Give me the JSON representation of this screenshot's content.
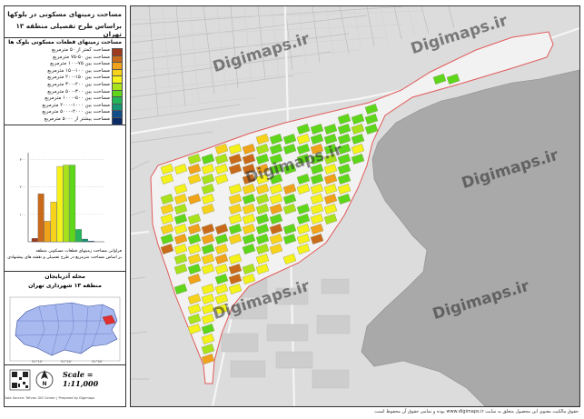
{
  "title": {
    "line1": "مساحت زمینهای مسکونی در بلوکها",
    "line2": "براساس طرح تفصیلی منطقه ۱۳ تهران"
  },
  "legend": {
    "title": "مساحت زمینهای قطعات مسکونی بلوک ها",
    "items": [
      {
        "label": "مساحت کمتر از ۵۰ مترمربع",
        "color": "#9e3b1e"
      },
      {
        "label": "مساحت بین ۵۰-۷۵ مترمربع",
        "color": "#c96a1a"
      },
      {
        "label": "مساحت بین ۷۵-۱۰۰ مترمربع",
        "color": "#f0a21a"
      },
      {
        "label": "مساحت بین ۱۰۰-۱۵۰ مترمربع",
        "color": "#f7d21a"
      },
      {
        "label": "مساحت بین ۱۵۰-۲۰۰ مترمربع",
        "color": "#f4f21a"
      },
      {
        "label": "مساحت بین ۲۰۰-۳۰۰ مترمربع",
        "color": "#a8e21a"
      },
      {
        "label": "مساحت بین ۳۰۰-۵۰۰ مترمربع",
        "color": "#5ed61a"
      },
      {
        "label": "مساحت بین ۵۰۰-۱۰۰۰ مترمربع",
        "color": "#24b45a"
      },
      {
        "label": "مساحت بین ۱۰۰۰-۲۰۰۰ مترمربع",
        "color": "#169474"
      },
      {
        "label": "مساحت بین ۲۰۰۰-۵۰۰۰ مترمربع",
        "color": "#104e8a"
      },
      {
        "label": "مساحت بیشتر از ۵۰۰۰ مترمربع",
        "color": "#0a2b66"
      }
    ]
  },
  "chart_data": {
    "type": "bar",
    "categories": [
      "<50",
      "50-75",
      "75-100",
      "100-150",
      "150-200",
      "200-300",
      "300-500",
      "500-1000",
      "1000-2000",
      "2000-5000",
      ">5000"
    ],
    "values": [
      5,
      70,
      30,
      58,
      110,
      112,
      112,
      18,
      4,
      1,
      0
    ],
    "colors": [
      "#9e3b1e",
      "#c96a1a",
      "#f0a21a",
      "#f7d21a",
      "#f4f21a",
      "#a8e21a",
      "#5ed61a",
      "#24b45a",
      "#169474",
      "#104e8a",
      "#0a2b66"
    ],
    "ytick_labels": [
      "۳۰۰",
      "۲۰۰",
      "۱۰۰"
    ],
    "caption1": "فراوانی مساحت زمینهای قطعات مسکونی منطقه",
    "caption2": "بر اساس مساحت مترمربع در طرح تفصیلی و نقشه های پیشنهادی"
  },
  "region": {
    "line1": "محله آذربایجان",
    "line2": "منطقه ۱۳ شهرداری تهران"
  },
  "scale_label": "Scale = 1:11,000",
  "watermark": "Digimaps.ir",
  "footer_text": "حقوق مالکیت معنوی این محصول متعلق به سایت www.digimaps.ir بوده و تمامی حقوق آن محفوظ است.",
  "credit_text": "Data Source: Tehran GIS Center | Prepared by Digimaps"
}
